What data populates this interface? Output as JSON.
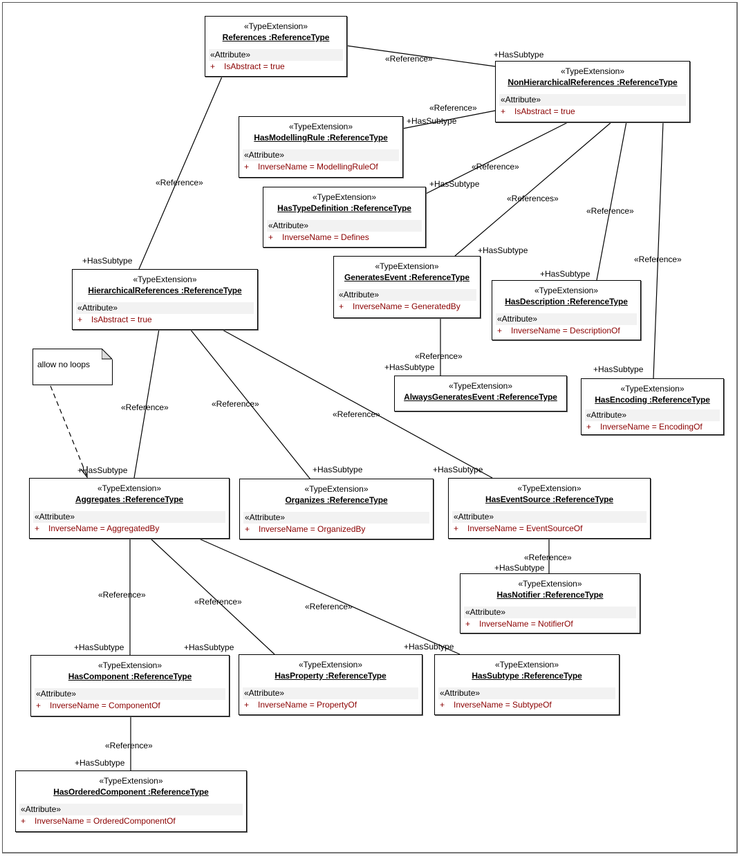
{
  "diagram": {
    "stereotype": "«TypeExtension»",
    "attribute_header": "«Attribute»",
    "attribute_marker": "+",
    "colors": {
      "attribute_text": "#8b0000",
      "compartment_bg": "#f2f2f2",
      "line": "#000000"
    }
  },
  "nodes": [
    {
      "id": "references",
      "title": "References :ReferenceType",
      "attribute": "IsAbstract = true"
    },
    {
      "id": "nonhier",
      "title": "NonHierarchicalReferences :ReferenceType",
      "attribute": "IsAbstract = true"
    },
    {
      "id": "hasmodellingrule",
      "title": "HasModellingRule :ReferenceType",
      "attribute": "InverseName = ModellingRuleOf"
    },
    {
      "id": "hastypedefinition",
      "title": "HasTypeDefinition :ReferenceType",
      "attribute": "InverseName = Defines"
    },
    {
      "id": "generatesevent",
      "title": "GeneratesEvent :ReferenceType",
      "attribute": "InverseName = GeneratedBy"
    },
    {
      "id": "hasdescription",
      "title": "HasDescription :ReferenceType",
      "attribute": "InverseName = DescriptionOf"
    },
    {
      "id": "hierarchical",
      "title": "HierarchicalReferences :ReferenceType",
      "attribute": "IsAbstract = true"
    },
    {
      "id": "alwaysgeneratesevent",
      "title": "AlwaysGeneratesEvent :ReferenceType",
      "attribute": null
    },
    {
      "id": "hasencoding",
      "title": "HasEncoding :ReferenceType",
      "attribute": "InverseName = EncodingOf"
    },
    {
      "id": "aggregates",
      "title": "Aggregates :ReferenceType",
      "attribute": "InverseName = AggregatedBy"
    },
    {
      "id": "organizes",
      "title": "Organizes :ReferenceType",
      "attribute": "InverseName = OrganizedBy"
    },
    {
      "id": "haseventsource",
      "title": "HasEventSource :ReferenceType",
      "attribute": "InverseName = EventSourceOf"
    },
    {
      "id": "hasnotifier",
      "title": "HasNotifier :ReferenceType",
      "attribute": "InverseName = NotifierOf"
    },
    {
      "id": "hascomponent",
      "title": "HasComponent :ReferenceType",
      "attribute": "InverseName = ComponentOf"
    },
    {
      "id": "hasproperty",
      "title": "HasProperty :ReferenceType",
      "attribute": "InverseName = PropertyOf"
    },
    {
      "id": "hassubtype",
      "title": "HasSubtype :ReferenceType",
      "attribute": "InverseName = SubtypeOf"
    },
    {
      "id": "hasorderedcomponent",
      "title": "HasOrderedComponent :ReferenceType",
      "attribute": "InverseName = OrderedComponentOf"
    }
  ],
  "note": {
    "text": "allow no loops",
    "attached_to": "aggregates"
  },
  "edges": [
    {
      "from": "references",
      "to": "nonhier",
      "stereotype": "«Reference»",
      "role": "+HasSubtype"
    },
    {
      "from": "references",
      "to": "hierarchical",
      "stereotype": "«Reference»",
      "role": "+HasSubtype"
    },
    {
      "from": "nonhier",
      "to": "hasmodellingrule",
      "stereotype": "«Reference»",
      "role": "+HasSubtype"
    },
    {
      "from": "nonhier",
      "to": "hastypedefinition",
      "stereotype": "«Reference»",
      "role": "+HasSubtype"
    },
    {
      "from": "nonhier",
      "to": "generatesevent",
      "stereotype": "«References»",
      "role": "+HasSubtype"
    },
    {
      "from": "nonhier",
      "to": "hasdescription",
      "stereotype": "«Reference»",
      "role": "+HasSubtype"
    },
    {
      "from": "nonhier",
      "to": "hasencoding",
      "stereotype": "«Reference»",
      "role": "+HasSubtype"
    },
    {
      "from": "generatesevent",
      "to": "alwaysgeneratesevent",
      "stereotype": "«Reference»",
      "role": "+HasSubtype"
    },
    {
      "from": "hierarchical",
      "to": "aggregates",
      "stereotype": "«Reference»",
      "role": "+HasSubtype"
    },
    {
      "from": "hierarchical",
      "to": "organizes",
      "stereotype": "«Reference»",
      "role": "+HasSubtype"
    },
    {
      "from": "hierarchical",
      "to": "haseventsource",
      "stereotype": "«Reference»",
      "role": "+HasSubtype"
    },
    {
      "from": "haseventsource",
      "to": "hasnotifier",
      "stereotype": "«Reference»",
      "role": "+HasSubtype"
    },
    {
      "from": "aggregates",
      "to": "hascomponent",
      "stereotype": "«Reference»",
      "role": "+HasSubtype"
    },
    {
      "from": "aggregates",
      "to": "hasproperty",
      "stereotype": "«Reference»",
      "role": "+HasSubtype"
    },
    {
      "from": "aggregates",
      "to": "hassubtype",
      "stereotype": "«Reference»",
      "role": "+HasSubtype"
    },
    {
      "from": "hascomponent",
      "to": "hasorderedcomponent",
      "stereotype": "«Reference»",
      "role": "+HasSubtype"
    }
  ]
}
